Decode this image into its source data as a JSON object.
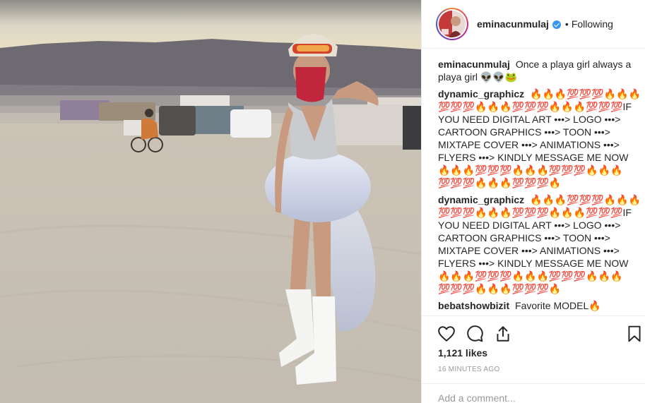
{
  "post": {
    "username": "eminacunmulaj",
    "follow_label": "Following",
    "separator": "•"
  },
  "comments": [
    {
      "user": "eminacunmulaj",
      "text": "Once a playa girl always a playa girl 👽👽🐸"
    },
    {
      "user": "dynamic_graphicz",
      "text": "🔥🔥🔥💯💯💯🔥🔥🔥💯💯💯🔥🔥🔥💯💯💯🔥🔥🔥💯💯💯IF YOU NEED DIGITAL ART •••> LOGO •••> CARTOON GRAPHICS •••> TOON •••> MIXTAPE COVER •••> ANIMATIONS •••> FLYERS •••> KINDLY MESSAGE ME NOW 🔥🔥🔥💯💯💯🔥🔥🔥💯💯💯🔥🔥🔥💯💯💯🔥🔥🔥💯💯💯🔥"
    },
    {
      "user": "dynamic_graphicz",
      "text": "🔥🔥🔥💯💯💯🔥🔥🔥💯💯💯🔥🔥🔥💯💯💯🔥🔥🔥💯💯💯IF YOU NEED DIGITAL ART •••> LOGO •••> CARTOON GRAPHICS •••> TOON •••> MIXTAPE COVER •••> ANIMATIONS •••> FLYERS •••> KINDLY MESSAGE ME NOW 🔥🔥🔥💯💯💯🔥🔥🔥💯💯💯🔥🔥🔥💯💯💯🔥🔥🔥💯💯💯🔥"
    },
    {
      "user": "bebatshowbizit",
      "text": "Favorite MODEL🔥"
    }
  ],
  "stats": {
    "likes": "1,121 likes",
    "time": "16 MINUTES AGO"
  },
  "add_comment": {
    "placeholder": "Add a comment..."
  },
  "icons": {
    "like": "heart-icon",
    "comment": "comment-icon",
    "share": "share-icon",
    "save": "bookmark-icon",
    "verified": "verified-badge-icon"
  },
  "colors": {
    "verified": "#3897f0",
    "border": "#efefef",
    "muted": "#999999",
    "text": "#262626"
  }
}
